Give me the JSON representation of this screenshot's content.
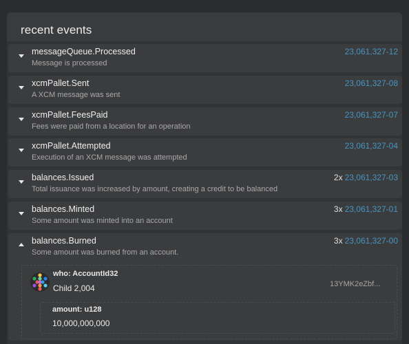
{
  "panel": {
    "title": "recent events"
  },
  "events": [
    {
      "name": "messageQueue.Processed",
      "description": "Message is processed",
      "count": "",
      "block": "23,061,327-12",
      "expanded": false
    },
    {
      "name": "xcmPallet.Sent",
      "description": "A XCM message was sent",
      "count": "",
      "block": "23,061,327-08",
      "expanded": false
    },
    {
      "name": "xcmPallet.FeesPaid",
      "description": "Fees were paid from a location for an operation",
      "count": "",
      "block": "23,061,327-07",
      "expanded": false
    },
    {
      "name": "xcmPallet.Attempted",
      "description": "Execution of an XCM message was attempted",
      "count": "",
      "block": "23,061,327-04",
      "expanded": false
    },
    {
      "name": "balances.Issued",
      "description": "Total issuance was increased by amount, creating a credit to be balanced",
      "count": "2x",
      "block": "23,061,327-03",
      "expanded": false
    },
    {
      "name": "balances.Minted",
      "description": "Some amount was minted into an account",
      "count": "3x",
      "block": "23,061,327-01",
      "expanded": false
    },
    {
      "name": "balances.Burned",
      "description": "Some amount was burned from an account.",
      "count": "3x",
      "block": "23,061,327-00",
      "expanded": true
    }
  ],
  "expanded_event": {
    "who_label": "who: AccountId32",
    "who_name": "Child 2,004",
    "who_address": "13YMK2eZbf...",
    "amount_label": "amount: u128",
    "amount_value": "10,000,000,000"
  },
  "colors": {
    "link": "#4596c4",
    "background": "#2b2c2e",
    "card": "#3b3c3e"
  },
  "icons": {
    "collapsed": "caret-down-icon",
    "expanded": "caret-up-icon",
    "account": "identicon-avatar"
  }
}
